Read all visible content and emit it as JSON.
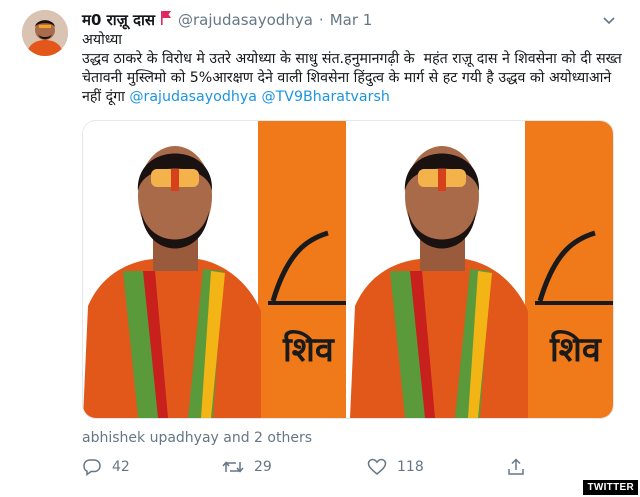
{
  "tweet": {
    "author_name": "म0 राज़ू दास",
    "handle": "@rajudasayodhya",
    "separator": "·",
    "date": "Mar 1",
    "body_line1": "अयोध्या",
    "body_text": "उद्धव ठाकरे के विरोध मे उतरे अयोध्या के साधु संत.हनुमानगढ़ी के  महंत राज़ू दास ने शिवसेना को दी सख्त चेतावनी मुस्लिमो को 5%आरक्षण देने वाली शिवसेना हिंदुत्व के मार्ग से हट गयी है उद्धव को अयोध्याआने नहीं दूंगा ",
    "mention1": "@rajudasayodhya",
    "mention2": "@TV9Bharatvarsh",
    "liked_by": "abhishek upadhyay and 2 others",
    "replies": "42",
    "retweets": "29",
    "likes": "118"
  },
  "photo_text": "शिव",
  "watermark": "TWITTER",
  "colors": {
    "link": "#1b95e0",
    "muted": "#657786",
    "saffron": "#f07a1a",
    "flag": "#e0245e"
  },
  "icons": [
    "flag-icon",
    "chevron-down-icon",
    "reply-icon",
    "retweet-icon",
    "like-icon",
    "share-icon"
  ]
}
